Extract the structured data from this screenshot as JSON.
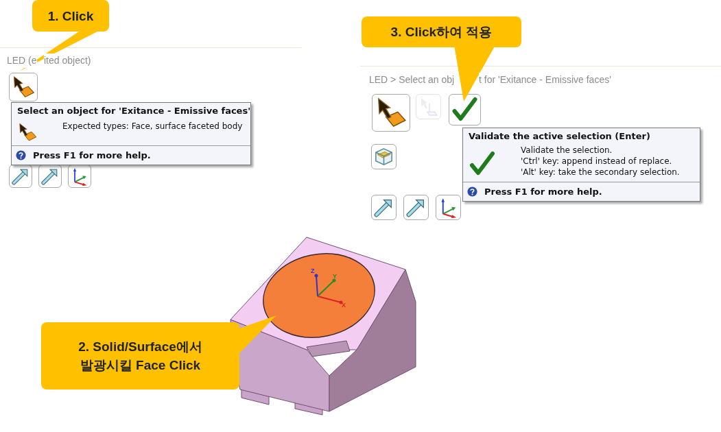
{
  "left_panel": {
    "title_parts": [
      "LED (e",
      "ited object)"
    ],
    "buttons": [
      {
        "kind": "select",
        "disabled": false
      }
    ],
    "axis_buttons": [
      {
        "kind": "axis-x"
      },
      {
        "kind": "axis-y"
      },
      {
        "kind": "axes"
      }
    ],
    "tooltip": {
      "title": "Select an object for 'Exitance - Emissive faces'",
      "kind": "select",
      "lines": [
        "Expected types: Face, surface faceted body"
      ],
      "help": "Press F1 for more help."
    }
  },
  "right_panel": {
    "breadcrumb_parts": [
      "LED > Select an obj",
      "t for 'Exitance - Emissive faces'"
    ],
    "buttons": [
      {
        "kind": "select",
        "disabled": false
      },
      {
        "kind": "pick",
        "disabled": true
      },
      {
        "kind": "check",
        "disabled": false
      }
    ],
    "extra_buttons": [
      {
        "kind": "box"
      }
    ],
    "axis_buttons": [
      {
        "kind": "axis-x"
      },
      {
        "kind": "axis-y"
      },
      {
        "kind": "axes"
      }
    ],
    "tooltip": {
      "title": "Validate the active selection (Enter)",
      "kind": "check",
      "lines": [
        "Validate the selection.",
        "'Ctrl' key: append instead of replace.",
        "'Alt' key: take the secondary selection."
      ],
      "help": "Press F1 for more help."
    }
  },
  "viewport": {
    "axes": [
      {
        "label": "Z"
      },
      {
        "label": "Y"
      },
      {
        "label": "X"
      }
    ]
  },
  "callouts": [
    {
      "lines": [
        "1. Click"
      ]
    },
    {
      "lines": [
        "2. Solid/Surface에서",
        "발광시킬 Face Click"
      ]
    },
    {
      "lines": [
        "3. Click하여 적용"
      ]
    }
  ]
}
